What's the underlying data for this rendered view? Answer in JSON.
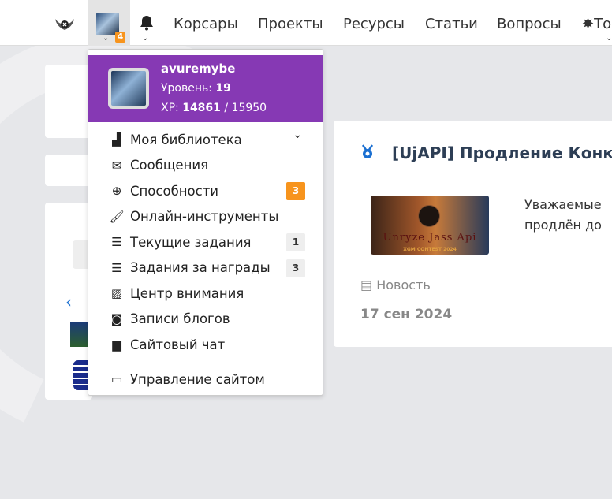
{
  "nav": {
    "notifications_count": "4",
    "items": [
      "Корсары",
      "Проекты",
      "Ресурсы",
      "Статьи",
      "Вопросы",
      "То"
    ]
  },
  "user": {
    "name": "avuremybe",
    "level_label": "Уровень:",
    "level": "19",
    "xp_label": "XP:",
    "xp": "14861",
    "xp_max": "/ 15950"
  },
  "menu": [
    {
      "label": "Моя библиотека",
      "icon": "library-icon"
    },
    {
      "label": "Сообщения",
      "icon": "envelope-icon"
    },
    {
      "label": "Способности",
      "icon": "arrow-up-circle-icon",
      "count": "3",
      "count_color": "#f7941d"
    },
    {
      "label": "Онлайн-инструменты",
      "icon": "brush-icon"
    },
    {
      "label": "Текущие задания",
      "icon": "tasks-icon",
      "count": "1"
    },
    {
      "label": "Задания за награды",
      "icon": "tasks-icon",
      "count": "3"
    },
    {
      "label": "Центр внимания",
      "icon": "image-icon"
    },
    {
      "label": "Записи блогов",
      "icon": "reader-icon"
    },
    {
      "label": "Сайтовый чат",
      "icon": "chat-icon"
    },
    {
      "label": "Управление сайтом",
      "icon": "monitor-icon"
    }
  ],
  "post": {
    "title": "[UjAPI] Продление Конк",
    "thumb_text": "Unryze Jass Api",
    "thumb_sub": "XGM CONTEST 2024",
    "text_lines": [
      "Уважаемые",
      "продлён до"
    ],
    "type": "Новость",
    "date": "17 сен 2024"
  },
  "colors": {
    "accent": "#8639b4",
    "badge": "#f7941d",
    "link": "#1a6fd1"
  }
}
